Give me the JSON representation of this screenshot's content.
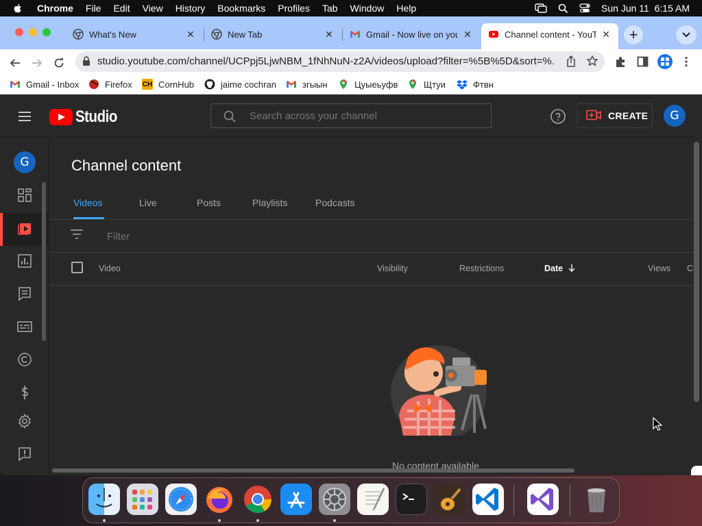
{
  "menubar": {
    "app_name": "Chrome",
    "items": [
      "File",
      "Edit",
      "View",
      "History",
      "Bookmarks",
      "Profiles",
      "Tab",
      "Window",
      "Help"
    ],
    "clock": "Sun Jun 11  6:15 AM"
  },
  "browser": {
    "tabs": [
      {
        "title": "What's New",
        "icon": "chrome-icon"
      },
      {
        "title": "New Tab",
        "icon": "chrome-icon"
      },
      {
        "title": "Gmail - Now live on your",
        "icon": "gmail-icon"
      },
      {
        "title": "Channel content - YouTu",
        "icon": "youtube-icon",
        "active": true
      }
    ],
    "url": "studio.youtube.com/channel/UCPpj5LjwNBM_1fNhNuN-z2A/videos/upload?filter=%5B%5D&sort=%...",
    "bookmarks": [
      {
        "label": "Gmail - Inbox",
        "icon": "gmail-icon"
      },
      {
        "label": "Firefox",
        "icon": "firefox-icon"
      },
      {
        "label": "CornHub",
        "icon": "cornhub-icon"
      },
      {
        "label": "jaime cochran",
        "icon": "github-icon"
      },
      {
        "label": "згыын",
        "icon": "gmail-icon"
      },
      {
        "label": "Цуыеьуфв",
        "icon": "maps-pin-icon"
      },
      {
        "label": "Щтуи",
        "icon": "maps-pin-icon"
      },
      {
        "label": "Фтвн",
        "icon": "dropbox-icon"
      }
    ]
  },
  "studio": {
    "logo_text": "Studio",
    "search_placeholder": "Search across your channel",
    "create_label": "CREATE",
    "avatar_letter": "G",
    "page_title": "Channel content",
    "tabs": [
      "Videos",
      "Live",
      "Posts",
      "Playlists",
      "Podcasts"
    ],
    "active_tab": "Videos",
    "filter_placeholder": "Filter",
    "columns": {
      "video": "Video",
      "visibility": "Visibility",
      "restrictions": "Restrictions",
      "date": "Date",
      "views": "Views",
      "comments": "C"
    },
    "empty_message": "No content available",
    "sidebar_icons": [
      "dashboard-icon",
      "content-icon",
      "analytics-icon",
      "comments-icon",
      "subtitles-icon",
      "copyright-icon",
      "earn-icon",
      "settings-icon",
      "feedback-icon"
    ]
  },
  "dock": {
    "apps": [
      "finder-icon",
      "launchpad-icon",
      "safari-icon",
      "firefox-icon",
      "chrome-icon",
      "app-store-icon",
      "system-preferences-icon",
      "textedit-icon",
      "terminal-icon",
      "garageband-icon",
      "vscode-icon",
      "visual-studio-icon",
      "trash-icon"
    ]
  },
  "colors": {
    "accent": "#3ea6ff",
    "youtube_red": "#ff0000",
    "studio_bg": "#282828",
    "tab_strip": "#a8c7fa"
  }
}
